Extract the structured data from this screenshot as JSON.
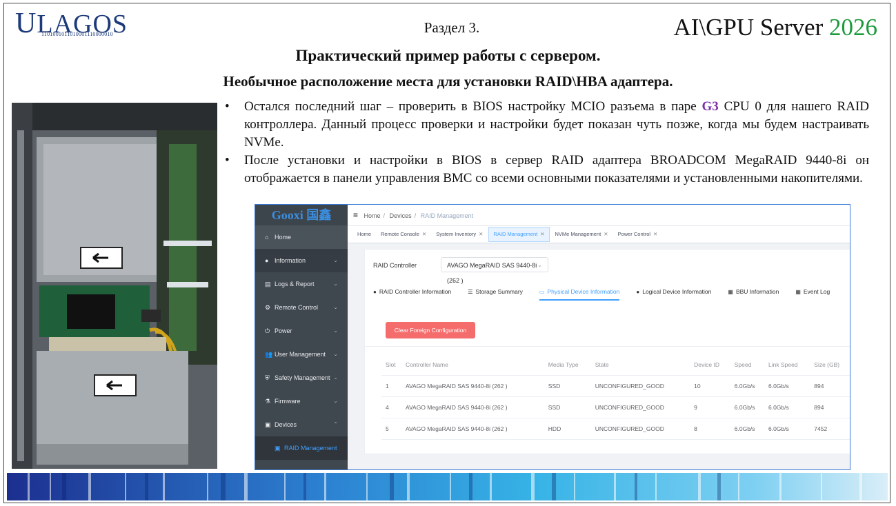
{
  "slide": {
    "logo_text": "LAGOS",
    "logo_letter": "U",
    "logo_bits": "1101001011010001110000010",
    "section": "Раздел 3.",
    "brand_prefix": "AI\\GPU Server ",
    "brand_year": "2026",
    "heading": "Практический пример работы с сервером.",
    "subheading": "Необычное расположение места для установки RAID\\HBA адаптера.",
    "bullets": [
      {
        "before": "Остался последний шаг – проверить в BIOS настройку MCIO разъема в паре ",
        "highlight": "G3",
        "after": " CPU 0 для нашего RAID контроллера. Данный процесс проверки и настройки будет показан чуть позже, когда мы будем настраивать NVMe."
      },
      {
        "text": "После установки и настройки в BIOS в сервер RAID адаптера BROADCOM MegaRAID 9440-8i он отображается в панели управления BMC со всеми основными показателями и установленными накопителями."
      }
    ],
    "highlight_color": "#7b2fa8",
    "year_color": "#1a9a3a"
  },
  "bmc": {
    "logo": "Gooxi 国鑫",
    "breadcrumb": [
      "Home",
      "Devices",
      "RAID Management"
    ],
    "sidebar": [
      {
        "label": "Home",
        "icon": "home-icon"
      },
      {
        "label": "Information",
        "icon": "info-icon"
      },
      {
        "label": "Logs & Report",
        "icon": "logs-icon"
      },
      {
        "label": "Remote Control",
        "icon": "remote-control-icon"
      },
      {
        "label": "Power",
        "icon": "power-icon"
      },
      {
        "label": "User Management",
        "icon": "users-icon"
      },
      {
        "label": "Safety Management",
        "icon": "shield-icon"
      },
      {
        "label": "Firmware",
        "icon": "firmware-icon"
      },
      {
        "label": "Devices",
        "icon": "devices-icon"
      }
    ],
    "sidebar_sub": "RAID Management",
    "tabs": [
      {
        "label": "Home"
      },
      {
        "label": "Remote Console"
      },
      {
        "label": "System Inventory"
      },
      {
        "label": "RAID Management"
      },
      {
        "label": "NVMe Management"
      },
      {
        "label": "Power Control"
      }
    ],
    "controller_label": "RAID Controller",
    "controller_value": "AVAGO MegaRAID SAS 9440-8i (262 )",
    "info_tabs": [
      {
        "label": "RAID Controller Information",
        "icon": "info-icon"
      },
      {
        "label": "Storage Summary",
        "icon": "storage-icon"
      },
      {
        "label": "Physical Device Information",
        "icon": "monitor-icon"
      },
      {
        "label": "Logical Device Information",
        "icon": "location-icon"
      },
      {
        "label": "BBU Information",
        "icon": "battery-icon"
      },
      {
        "label": "Event Log",
        "icon": "calendar-icon"
      }
    ],
    "clear_button": "Clear Foreign Configuration",
    "table": {
      "headers": [
        "Slot",
        "Controller Name",
        "Media Type",
        "State",
        "Device ID",
        "Speed",
        "Link Speed",
        "Size (GB)"
      ],
      "rows": [
        [
          "1",
          "AVAGO MegaRAID SAS 9440-8i (262 )",
          "SSD",
          "UNCONFIGURED_GOOD",
          "10",
          "6.0Gb/s",
          "6.0Gb/s",
          "894"
        ],
        [
          "4",
          "AVAGO MegaRAID SAS 9440-8i (262 )",
          "SSD",
          "UNCONFIGURED_GOOD",
          "9",
          "6.0Gb/s",
          "6.0Gb/s",
          "894"
        ],
        [
          "5",
          "AVAGO MegaRAID SAS 9440-8i (262 )",
          "HDD",
          "UNCONFIGURED_GOOD",
          "8",
          "6.0Gb/s",
          "6.0Gb/s",
          "7452"
        ]
      ]
    },
    "accent_color": "#409eff",
    "danger_color": "#f56c6c"
  }
}
